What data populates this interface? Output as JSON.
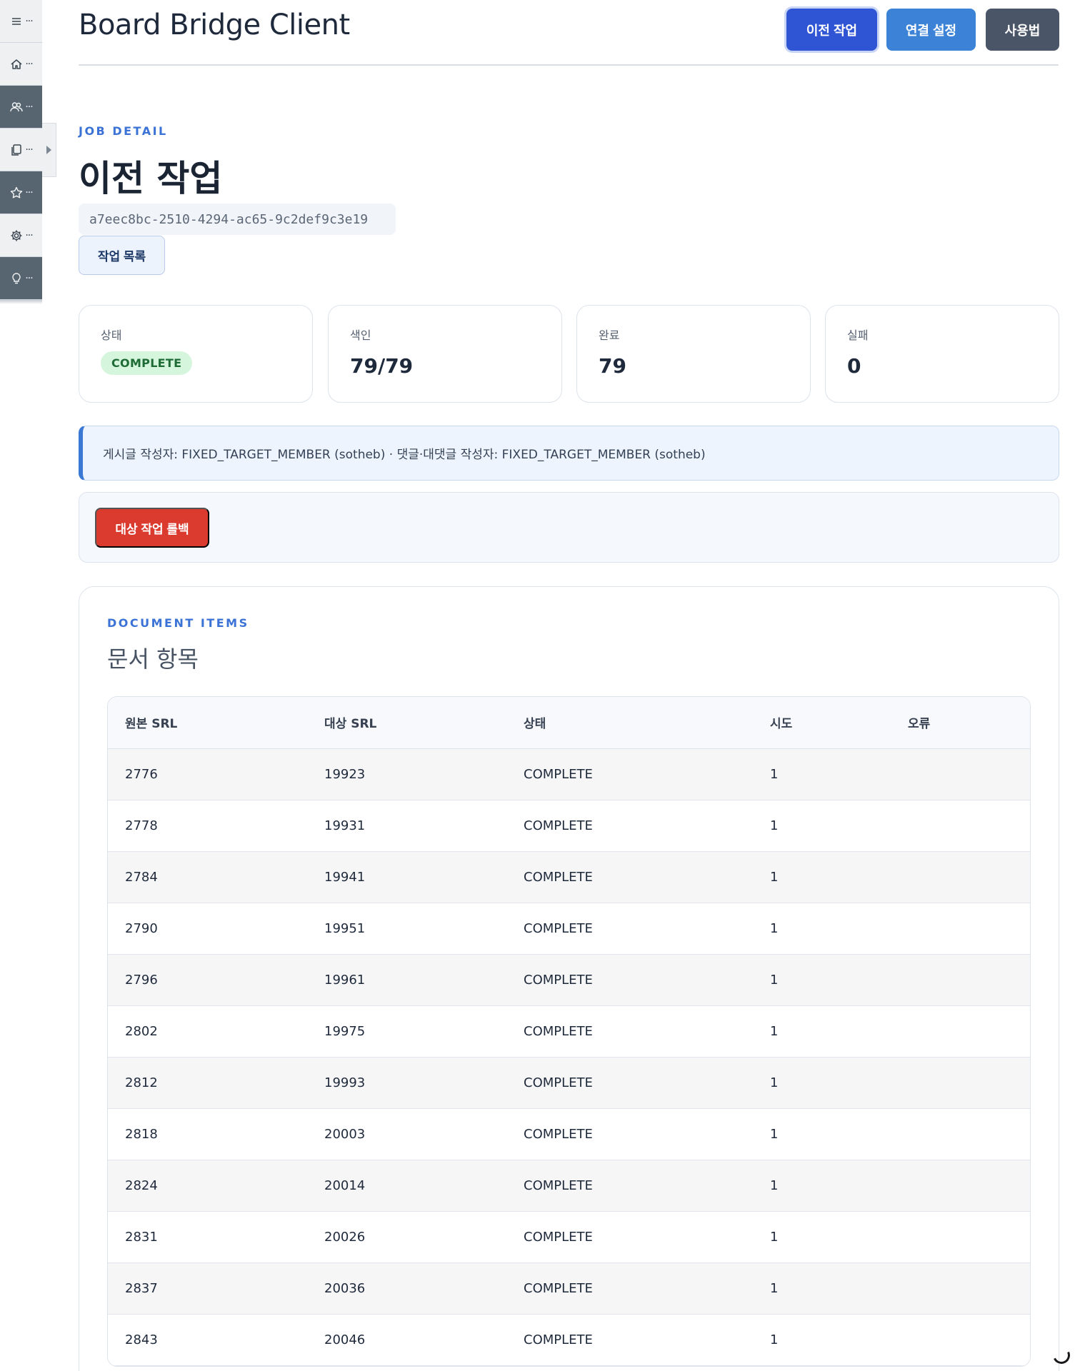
{
  "app": {
    "title": "Board Bridge Client"
  },
  "header": {
    "buttons": {
      "migration": "이전 작업",
      "connection": "연결 설정",
      "guide": "사용법"
    }
  },
  "sidebar": {
    "items": [
      {
        "icon": "menu-icon",
        "dots": "···"
      },
      {
        "icon": "home-icon",
        "dots": "···"
      },
      {
        "icon": "users-icon",
        "dots": "···"
      },
      {
        "icon": "copy-icon",
        "dots": "···"
      },
      {
        "icon": "star-icon",
        "dots": "···"
      },
      {
        "icon": "gear-icon",
        "dots": "···"
      },
      {
        "icon": "lightbulb-icon",
        "dots": "···"
      }
    ]
  },
  "job": {
    "eyebrow": "JOB DETAIL",
    "title": "이전 작업",
    "id": "a7eec8bc-2510-4294-ac65-9c2def9c3e19",
    "list_button": "작업 목록"
  },
  "stats": {
    "status": {
      "label": "상태",
      "value": "COMPLETE"
    },
    "indexed": {
      "label": "색인",
      "value": "79/79"
    },
    "completed": {
      "label": "완료",
      "value": "79"
    },
    "failed": {
      "label": "실패",
      "value": "0"
    }
  },
  "info_text": "게시글 작성자: FIXED_TARGET_MEMBER (sotheb) · 댓글·대댓글 작성자: FIXED_TARGET_MEMBER (sotheb)",
  "rollback_button": "대상 작업 롤백",
  "documents": {
    "eyebrow": "DOCUMENT ITEMS",
    "title": "문서 항목",
    "columns": [
      "원본 SRL",
      "대상 SRL",
      "상태",
      "시도",
      "오류"
    ],
    "rows": [
      [
        "2776",
        "19923",
        "COMPLETE",
        "1",
        ""
      ],
      [
        "2778",
        "19931",
        "COMPLETE",
        "1",
        ""
      ],
      [
        "2784",
        "19941",
        "COMPLETE",
        "1",
        ""
      ],
      [
        "2790",
        "19951",
        "COMPLETE",
        "1",
        ""
      ],
      [
        "2796",
        "19961",
        "COMPLETE",
        "1",
        ""
      ],
      [
        "2802",
        "19975",
        "COMPLETE",
        "1",
        ""
      ],
      [
        "2812",
        "19993",
        "COMPLETE",
        "1",
        ""
      ],
      [
        "2818",
        "20003",
        "COMPLETE",
        "1",
        ""
      ],
      [
        "2824",
        "20014",
        "COMPLETE",
        "1",
        ""
      ],
      [
        "2831",
        "20026",
        "COMPLETE",
        "1",
        ""
      ],
      [
        "2837",
        "20036",
        "COMPLETE",
        "1",
        ""
      ],
      [
        "2843",
        "20046",
        "COMPLETE",
        "1",
        ""
      ]
    ]
  },
  "colors": {
    "accent": "#2f55d4",
    "secondary": "#3c82d6",
    "dark": "#4a5568",
    "danger": "#db3a2f",
    "success_bg": "#d6f5dd",
    "eyebrow": "#3b72d6"
  }
}
